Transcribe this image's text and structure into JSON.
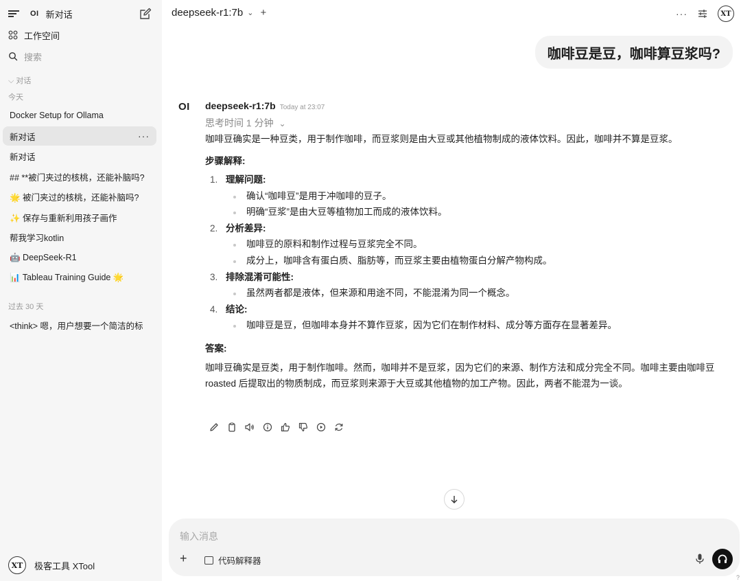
{
  "sidebar": {
    "logo": "OI",
    "new_chat": "新对话",
    "workspace": "工作空间",
    "search_placeholder": "搜索",
    "section_chats": "对话",
    "group_today": "今天",
    "group_past30": "过去 30 天",
    "items_today": [
      "Docker Setup for Ollama",
      "新对话",
      "新对话",
      "## **被门夹过的核桃，还能补脑吗?",
      "🌟 被门夹过的核桃，还能补脑吗?",
      "✨ 保存与重新利用孩子画作",
      "帮我学习kotlin",
      "🤖 DeepSeek-R1",
      "📊 Tableau Training Guide 🌟"
    ],
    "items_past30": [
      "<think> 嗯，用户想要一个简洁的标"
    ],
    "user_avatar": "XT",
    "user_name": "极客工具 XTool"
  },
  "topbar": {
    "model": "deepseek-r1:7b",
    "more": "···",
    "avatar": "XT"
  },
  "chat": {
    "user_message": "咖啡豆是豆，咖啡算豆浆吗?",
    "assistant": {
      "logo": "OI",
      "name": "deepseek-r1:7b",
      "time": "Today at 23:07",
      "thinking": "思考时间 1 分钟",
      "intro": "咖啡豆确实是一种豆类，用于制作咖啡，而豆浆则是由大豆或其他植物制成的液体饮料。因此，咖啡并不算是豆浆。",
      "steps_heading": "步骤解释:",
      "steps": [
        {
          "num": "1.",
          "title": "理解问题:",
          "bullets": [
            "确认“咖啡豆”是用于冲咖啡的豆子。",
            "明确“豆浆”是由大豆等植物加工而成的液体饮料。"
          ]
        },
        {
          "num": "2.",
          "title": "分析差异:",
          "bullets": [
            "咖啡豆的原料和制作过程与豆浆完全不同。",
            "成分上，咖啡含有蛋白质、脂肪等，而豆浆主要由植物蛋白分解产物构成。"
          ]
        },
        {
          "num": "3.",
          "title": "排除混淆可能性:",
          "bullets": [
            "虽然两者都是液体，但来源和用途不同，不能混淆为同一个概念。"
          ]
        },
        {
          "num": "4.",
          "title": "结论:",
          "bullets": [
            "咖啡豆是豆，但咖啡本身并不算作豆浆，因为它们在制作材料、成分等方面存在显著差异。"
          ]
        }
      ],
      "answer_heading": "答案:",
      "answer_text": "咖啡豆确实是豆类，用于制作咖啡。然而，咖啡并不是豆浆，因为它们的来源、制作方法和成分完全不同。咖啡主要由咖啡豆 roasted 后提取出的物质制成，而豆浆则来源于大豆或其他植物的加工产物。因此，两者不能混为一谈。"
    }
  },
  "composer": {
    "placeholder": "输入消息",
    "plus": "+",
    "code_interpreter": "代码解释器",
    "help": "?"
  },
  "icons": {
    "accent": "#111111",
    "muted": "#9a9a9a"
  }
}
